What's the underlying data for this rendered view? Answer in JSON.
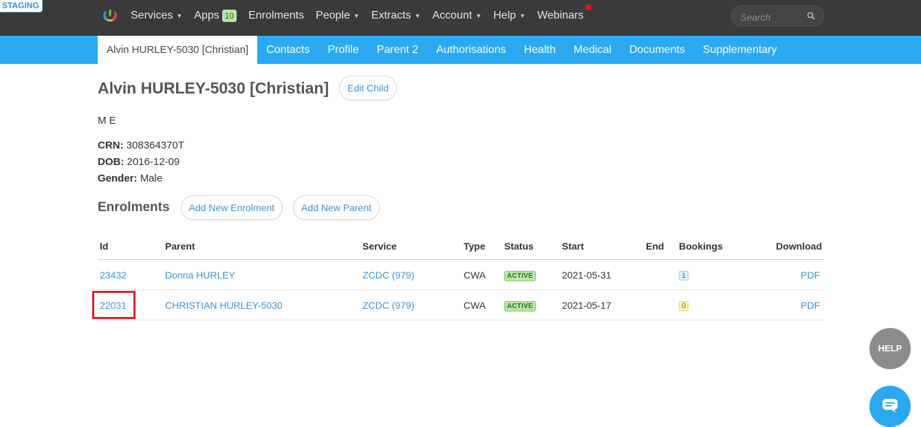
{
  "env_badge": "STAGING",
  "nav": {
    "items": [
      {
        "label": "Services",
        "caret": true
      },
      {
        "label": "Apps",
        "badge": "10"
      },
      {
        "label": "Enrolments"
      },
      {
        "label": "People",
        "caret": true
      },
      {
        "label": "Extracts",
        "caret": true
      },
      {
        "label": "Account",
        "caret": true
      },
      {
        "label": "Help",
        "caret": true
      },
      {
        "label": "Webinars"
      }
    ],
    "search_placeholder": "Search"
  },
  "subnav": {
    "tabs": [
      "Alvin HURLEY-5030 [Christian]",
      "Contacts",
      "Profile",
      "Parent 2",
      "Authorisations",
      "Health",
      "Medical",
      "Documents",
      "Supplementary"
    ]
  },
  "child": {
    "name": "Alvin HURLEY-5030 [Christian]",
    "edit_label": "Edit Child",
    "initials": "M E",
    "crn_label": "CRN:",
    "crn": "308364370T",
    "dob_label": "DOB:",
    "dob": "2016-12-09",
    "gender_label": "Gender:",
    "gender": "Male"
  },
  "enrolments": {
    "title": "Enrolments",
    "add_enrolment_label": "Add New Enrolment",
    "add_parent_label": "Add New Parent",
    "columns": [
      "Id",
      "Parent",
      "Service",
      "Type",
      "Status",
      "Start",
      "End",
      "Bookings",
      "Download"
    ],
    "rows": [
      {
        "id": "23432",
        "parent": "Donna HURLEY",
        "service": "ZCDC (979)",
        "type": "CWA",
        "status": "ACTIVE",
        "start": "2021-05-31",
        "end": "",
        "bookings": "1",
        "download": "PDF"
      },
      {
        "id": "22031",
        "parent": "CHRISTIAN HURLEY-5030",
        "service": "ZCDC (979)",
        "type": "CWA",
        "status": "ACTIVE",
        "start": "2021-05-17",
        "end": "",
        "bookings": "0",
        "download": "PDF"
      }
    ]
  },
  "help_label": "HELP",
  "colors": {
    "topbar": "#3a3a3a",
    "subnav": "#2aa9f1",
    "link": "#3d93d0",
    "highlight": "#e0202a"
  }
}
